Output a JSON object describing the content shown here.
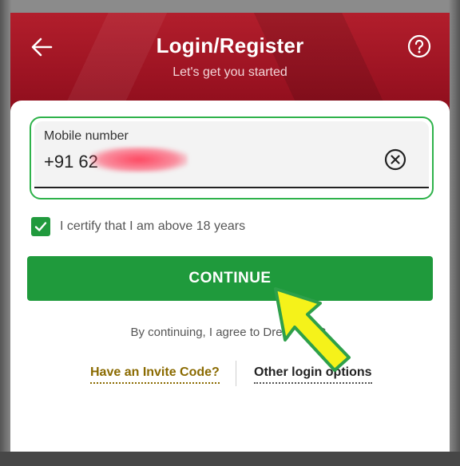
{
  "header": {
    "title": "Login/Register",
    "subtitle": "Let's get you started",
    "back_icon": "arrow-left-icon",
    "help_icon": "question-circle-icon",
    "background_color": "#9c1322"
  },
  "phone_field": {
    "label": "Mobile number",
    "value": "+91 62",
    "clear_icon": "close-circle-icon",
    "border_color": "#2eb24a"
  },
  "certify": {
    "checked": true,
    "label": "I certify that I am above 18 years"
  },
  "continue_button": {
    "label": "CONTINUE",
    "color": "#1f9a3c"
  },
  "agree_text": "By continuing, I agree to Dre      T&C.",
  "links": {
    "invite": "Have an Invite Code?",
    "other": "Other login options"
  },
  "overlay": {
    "arrow_color": "#f5f21a"
  }
}
